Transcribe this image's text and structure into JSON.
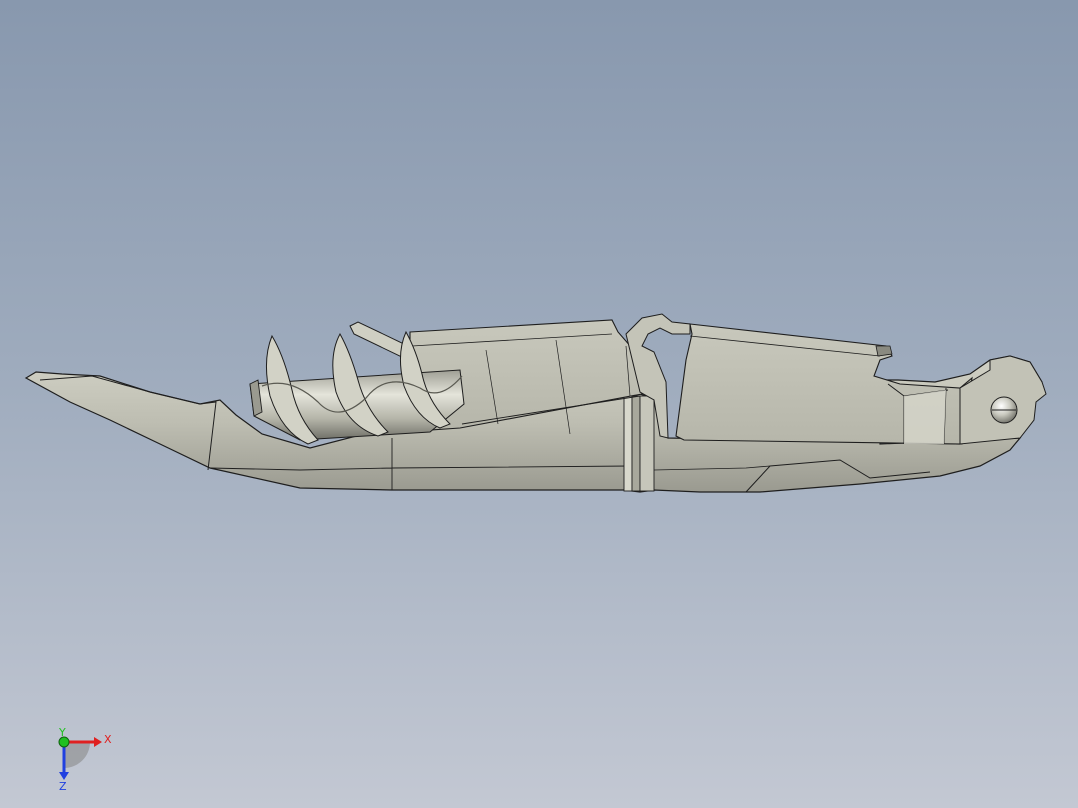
{
  "viewport": {
    "background_top": "#8898ae",
    "background_bottom": "#c3c8d3"
  },
  "model": {
    "name": "corkscrew-waiters-friend",
    "body_color": "#bfbfb3",
    "shadow_color": "#8c8c82",
    "edge_color": "#1e1e1e"
  },
  "triad": {
    "x_label": "X",
    "y_label": "Y",
    "z_label": "Z",
    "x_color": "#e02020",
    "y_color": "#20c020",
    "z_color": "#2040e0"
  }
}
